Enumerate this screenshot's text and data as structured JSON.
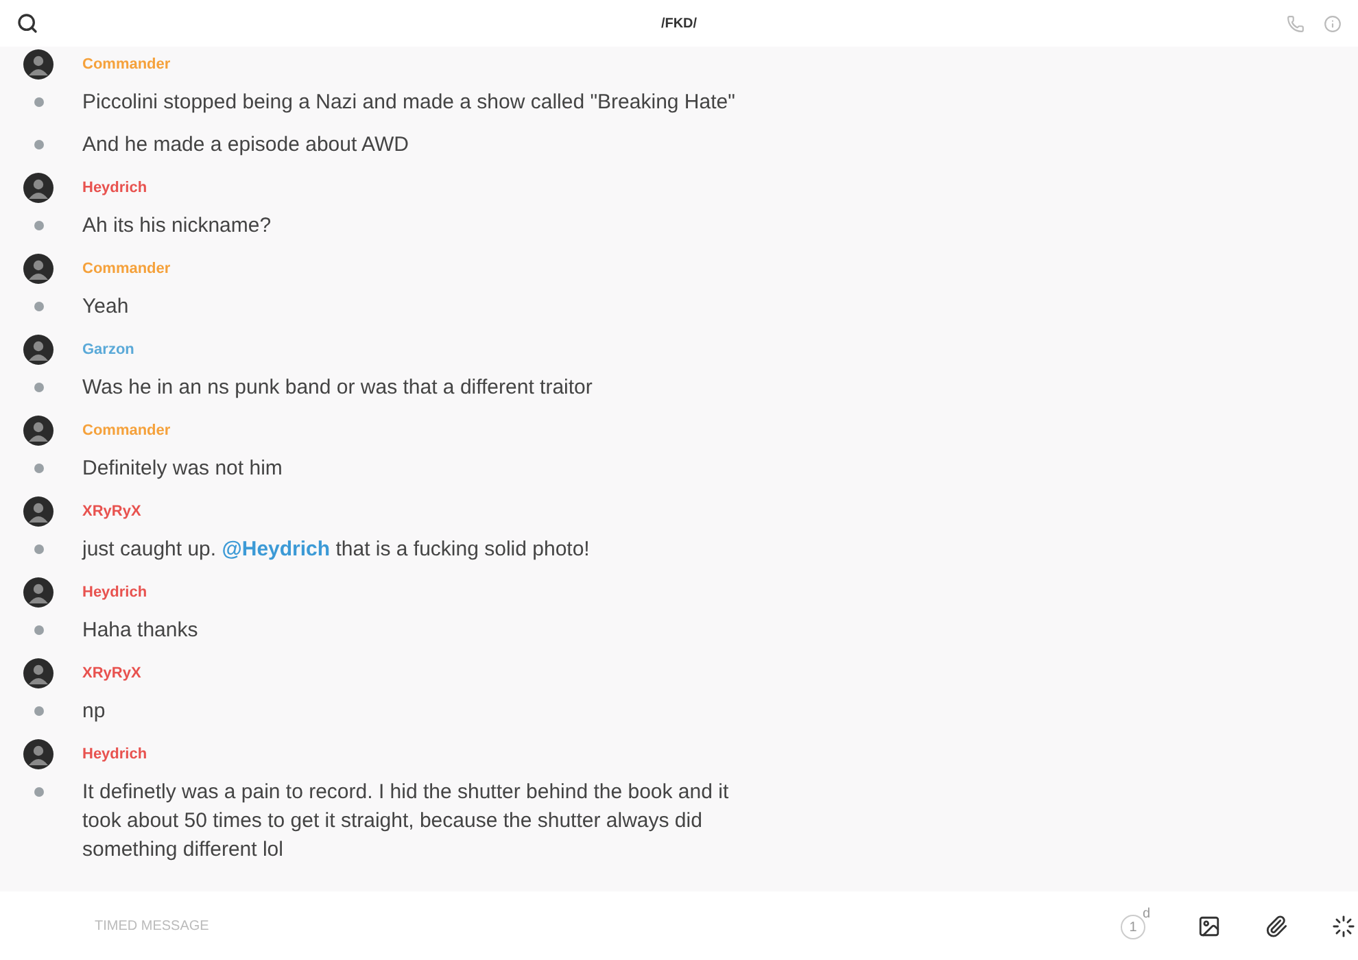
{
  "header": {
    "title": "/FKD/"
  },
  "messages": [
    {
      "author": "Commander",
      "color": "#f5a13b",
      "lines": [
        [
          {
            "kind": "text",
            "text": "Piccolini stopped being a Nazi and made a show called \"Breaking Hate\""
          }
        ],
        [
          {
            "kind": "text",
            "text": "And he made a episode about AWD"
          }
        ]
      ]
    },
    {
      "author": "Heydrich",
      "color": "#e8524f",
      "lines": [
        [
          {
            "kind": "text",
            "text": "Ah its his nickname?"
          }
        ]
      ]
    },
    {
      "author": "Commander",
      "color": "#f5a13b",
      "lines": [
        [
          {
            "kind": "text",
            "text": "Yeah"
          }
        ]
      ]
    },
    {
      "author": "Garzon",
      "color": "#5aa9d8",
      "lines": [
        [
          {
            "kind": "text",
            "text": "Was he in an ns punk band or was that a different traitor"
          }
        ]
      ]
    },
    {
      "author": "Commander",
      "color": "#f5a13b",
      "lines": [
        [
          {
            "kind": "text",
            "text": "Definitely was not him"
          }
        ]
      ]
    },
    {
      "author": "XRyRyX",
      "color": "#e8524f",
      "lines": [
        [
          {
            "kind": "text",
            "text": "just caught up. "
          },
          {
            "kind": "mention",
            "text": "@Heydrich"
          },
          {
            "kind": "text",
            "text": " that is a fucking solid photo!"
          }
        ]
      ]
    },
    {
      "author": "Heydrich",
      "color": "#e8524f",
      "lines": [
        [
          {
            "kind": "text",
            "text": "Haha thanks"
          }
        ]
      ]
    },
    {
      "author": "XRyRyX",
      "color": "#e8524f",
      "lines": [
        [
          {
            "kind": "text",
            "text": "np"
          }
        ]
      ]
    },
    {
      "author": "Heydrich",
      "color": "#e8524f",
      "lines": [
        [
          {
            "kind": "text",
            "text": "It definetly was a pain to record. I hid the shutter behind the book and it took about 50 times to get it straight, because the shutter always did something different lol"
          }
        ]
      ]
    }
  ],
  "composer": {
    "placeholder": "TIMED MESSAGE",
    "timer": {
      "value": "1",
      "unit": "d"
    }
  }
}
